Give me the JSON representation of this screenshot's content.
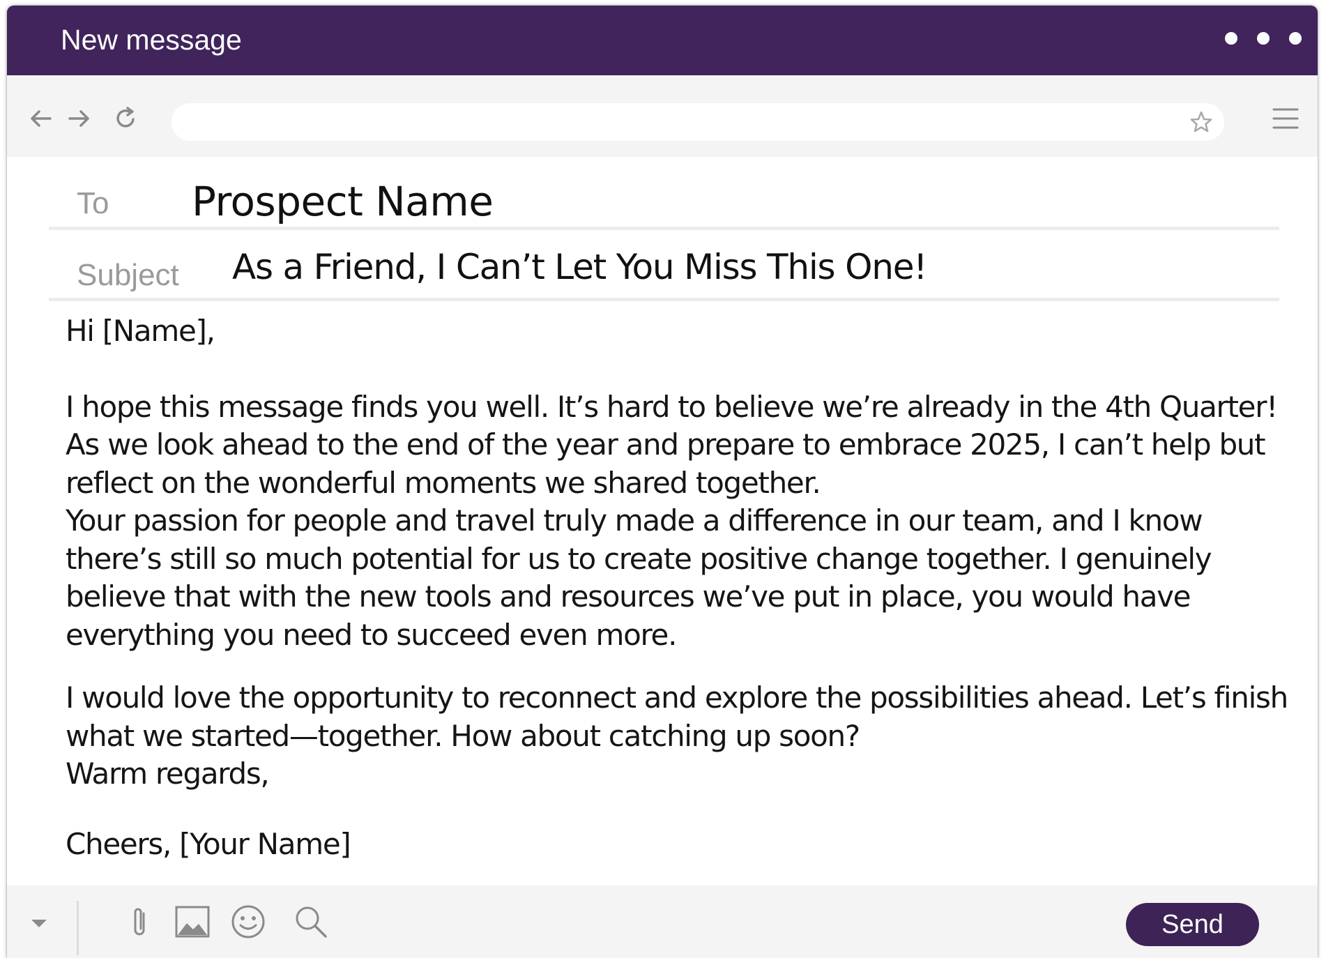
{
  "window": {
    "title": "New message"
  },
  "toolbar": {
    "address_value": ""
  },
  "compose": {
    "to_label": "To",
    "to_value": "Prospect Name",
    "subject_label": "Subject",
    "subject_value": "As a Friend, I Can’t Let You Miss This One!"
  },
  "message": {
    "greeting": "Hi [Name],",
    "paragraph_1": "I hope this message finds you well. It’s hard to believe we’re already in the 4th Quarter! As we look ahead to the end of the year and prepare to embrace 2025, I can’t help but reflect on the wonderful moments we shared together.",
    "paragraph_2": "Your passion for people and travel truly made a difference in our team, and I know there’s still so much potential for us to create positive change together. I genuinely believe that with the new tools and resources we’ve put in place, you would have everything you need to succeed even more.",
    "paragraph_3": "I would love the opportunity to reconnect and explore the possibilities ahead. Let’s finish what we started—together. How about catching up soon?",
    "closing": "Warm regards,",
    "signoff": "Cheers,  [Your Name]"
  },
  "actions": {
    "send_label": "Send"
  },
  "colors": {
    "titlebar": "#40245b",
    "send_button": "#3d2356",
    "toolbar_bg": "#f4f4f4",
    "label_gray": "#9a9a9a"
  },
  "icons": [
    "more-dots-icon",
    "back-arrow-icon",
    "forward-arrow-icon",
    "reload-icon",
    "bookmark-star-icon",
    "hamburger-menu-icon",
    "dropdown-caret-icon",
    "paperclip-icon",
    "image-icon",
    "emoji-icon",
    "search-icon"
  ]
}
